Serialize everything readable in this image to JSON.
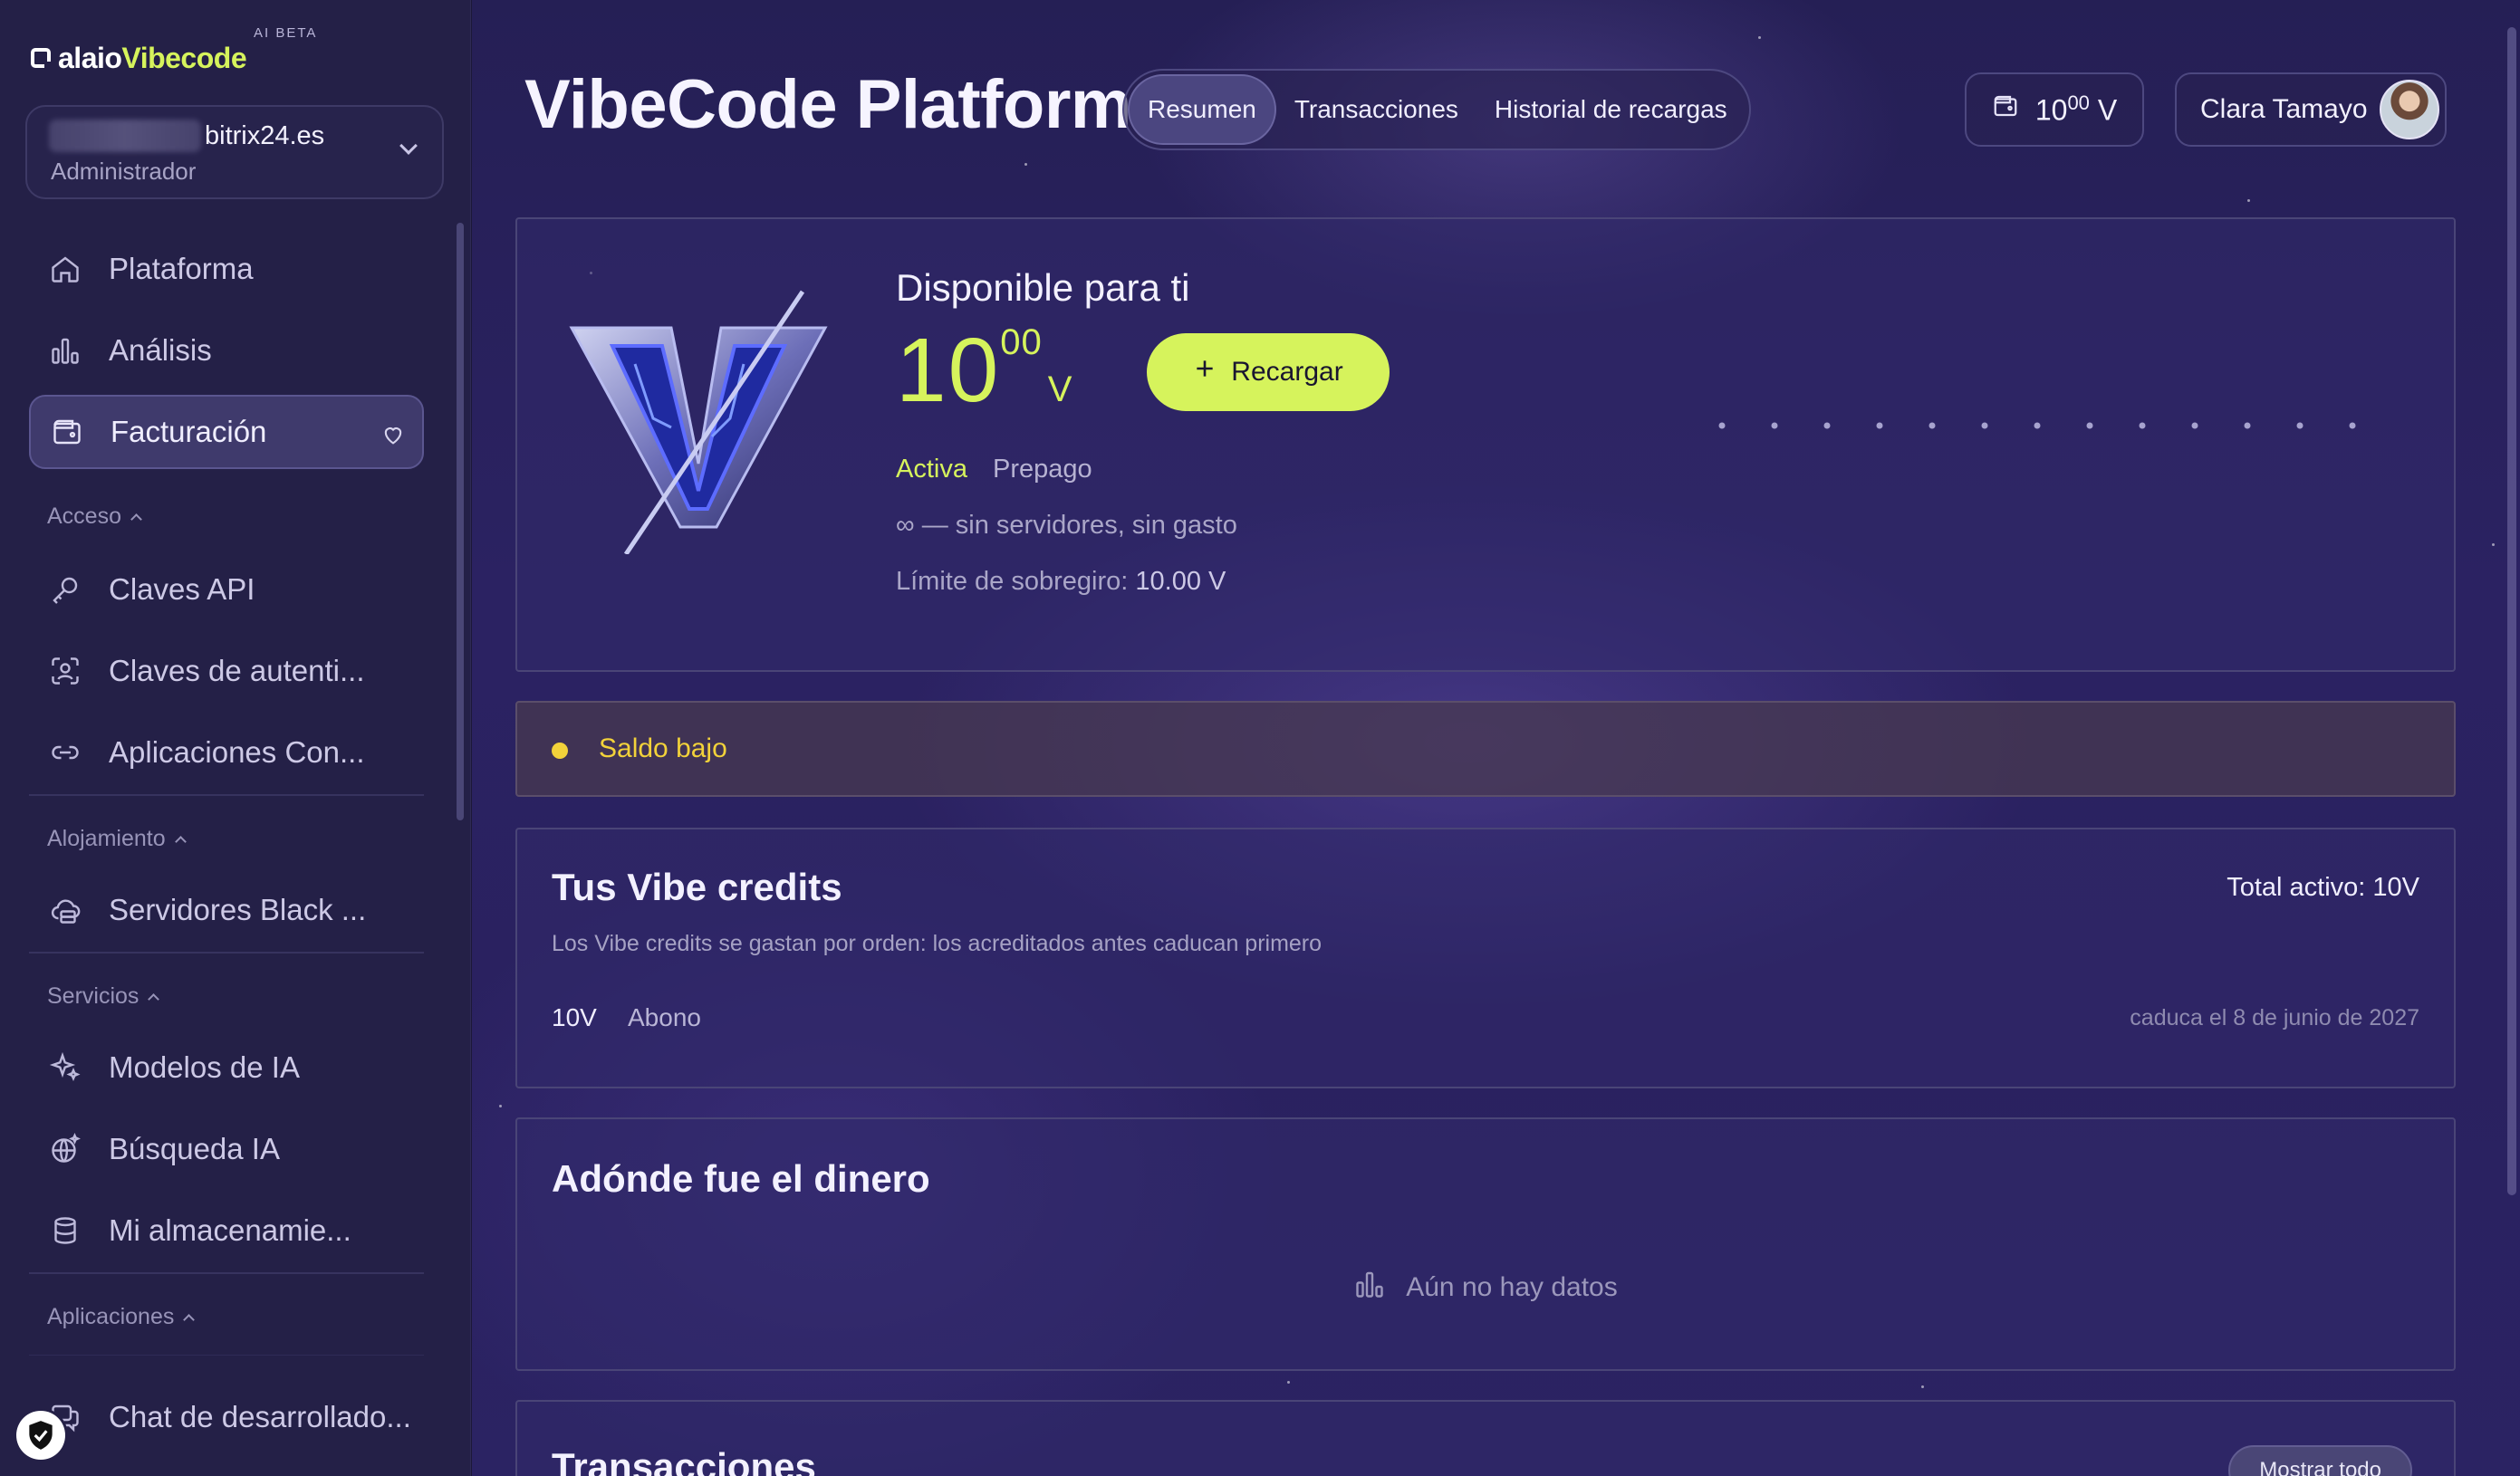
{
  "brand": {
    "name_a": "alaio",
    "name_b": "Vibecode",
    "beta": "AI BETA"
  },
  "org": {
    "domain": "bitrix24.es",
    "role": "Administrador"
  },
  "nav": {
    "top_items": [
      {
        "label": "Plataforma",
        "icon": "home-icon"
      },
      {
        "label": "Análisis",
        "icon": "chart-icon"
      },
      {
        "label": "Facturación",
        "icon": "wallet-icon"
      }
    ],
    "sections": {
      "acceso": "Acceso",
      "alojamiento": "Alojamiento",
      "servicios": "Servicios",
      "aplicaciones": "Aplicaciones"
    },
    "acceso_items": [
      {
        "label": "Claves API",
        "icon": "key-icon"
      },
      {
        "label": "Claves de autenti...",
        "icon": "auth-key-icon"
      },
      {
        "label": "Aplicaciones Con...",
        "icon": "link-icon"
      }
    ],
    "alojamiento_items": [
      {
        "label": "Servidores Black ...",
        "icon": "server-icon"
      }
    ],
    "servicios_items": [
      {
        "label": "Modelos de IA",
        "icon": "sparkles-icon"
      },
      {
        "label": "Búsqueda IA",
        "icon": "globe-sparkle-icon"
      },
      {
        "label": "Mi almacenamie...",
        "icon": "database-icon"
      }
    ],
    "aplicaciones_items": [
      {
        "label": "Chat de desarrollado...",
        "icon": "chat-icon"
      }
    ]
  },
  "header": {
    "title": "VibeCode Platform",
    "tabs": [
      "Resumen",
      "Transacciones",
      "Historial de recargas"
    ],
    "active_tab": "Resumen",
    "balance_int": "10",
    "balance_dec": "00",
    "currency": "V",
    "user_name": "Clara Tamayo"
  },
  "hero": {
    "available_label": "Disponible para ti",
    "amount_int": "10",
    "amount_dec": "00",
    "currency": "V",
    "recharge_label": "Recargar",
    "status": "Activa",
    "plan": "Prepago",
    "servers_info": "∞ — sin servidores, sin gasto",
    "overdraft_label": "Límite de sobregiro:",
    "overdraft_value": "10.00 V"
  },
  "alert": {
    "text": "Saldo bajo",
    "color": "#f2d23a"
  },
  "credits": {
    "title": "Tus Vibe credits",
    "total": "Total activo: 10V",
    "subtitle": "Los Vibe credits se gastan por orden: los acreditados antes caducan primero",
    "rows": [
      {
        "amount": "10V",
        "type": "Abono",
        "expires": "caduca el 8 de junio de 2027"
      }
    ]
  },
  "money": {
    "title": "Adónde fue el dinero",
    "empty": "Aún no hay datos"
  },
  "transactions": {
    "title": "Transacciones",
    "show_all": "Mostrar todo"
  },
  "colors": {
    "accent": "#d6f35c",
    "sidebar": "#242047",
    "warning": "#f2d23a"
  }
}
